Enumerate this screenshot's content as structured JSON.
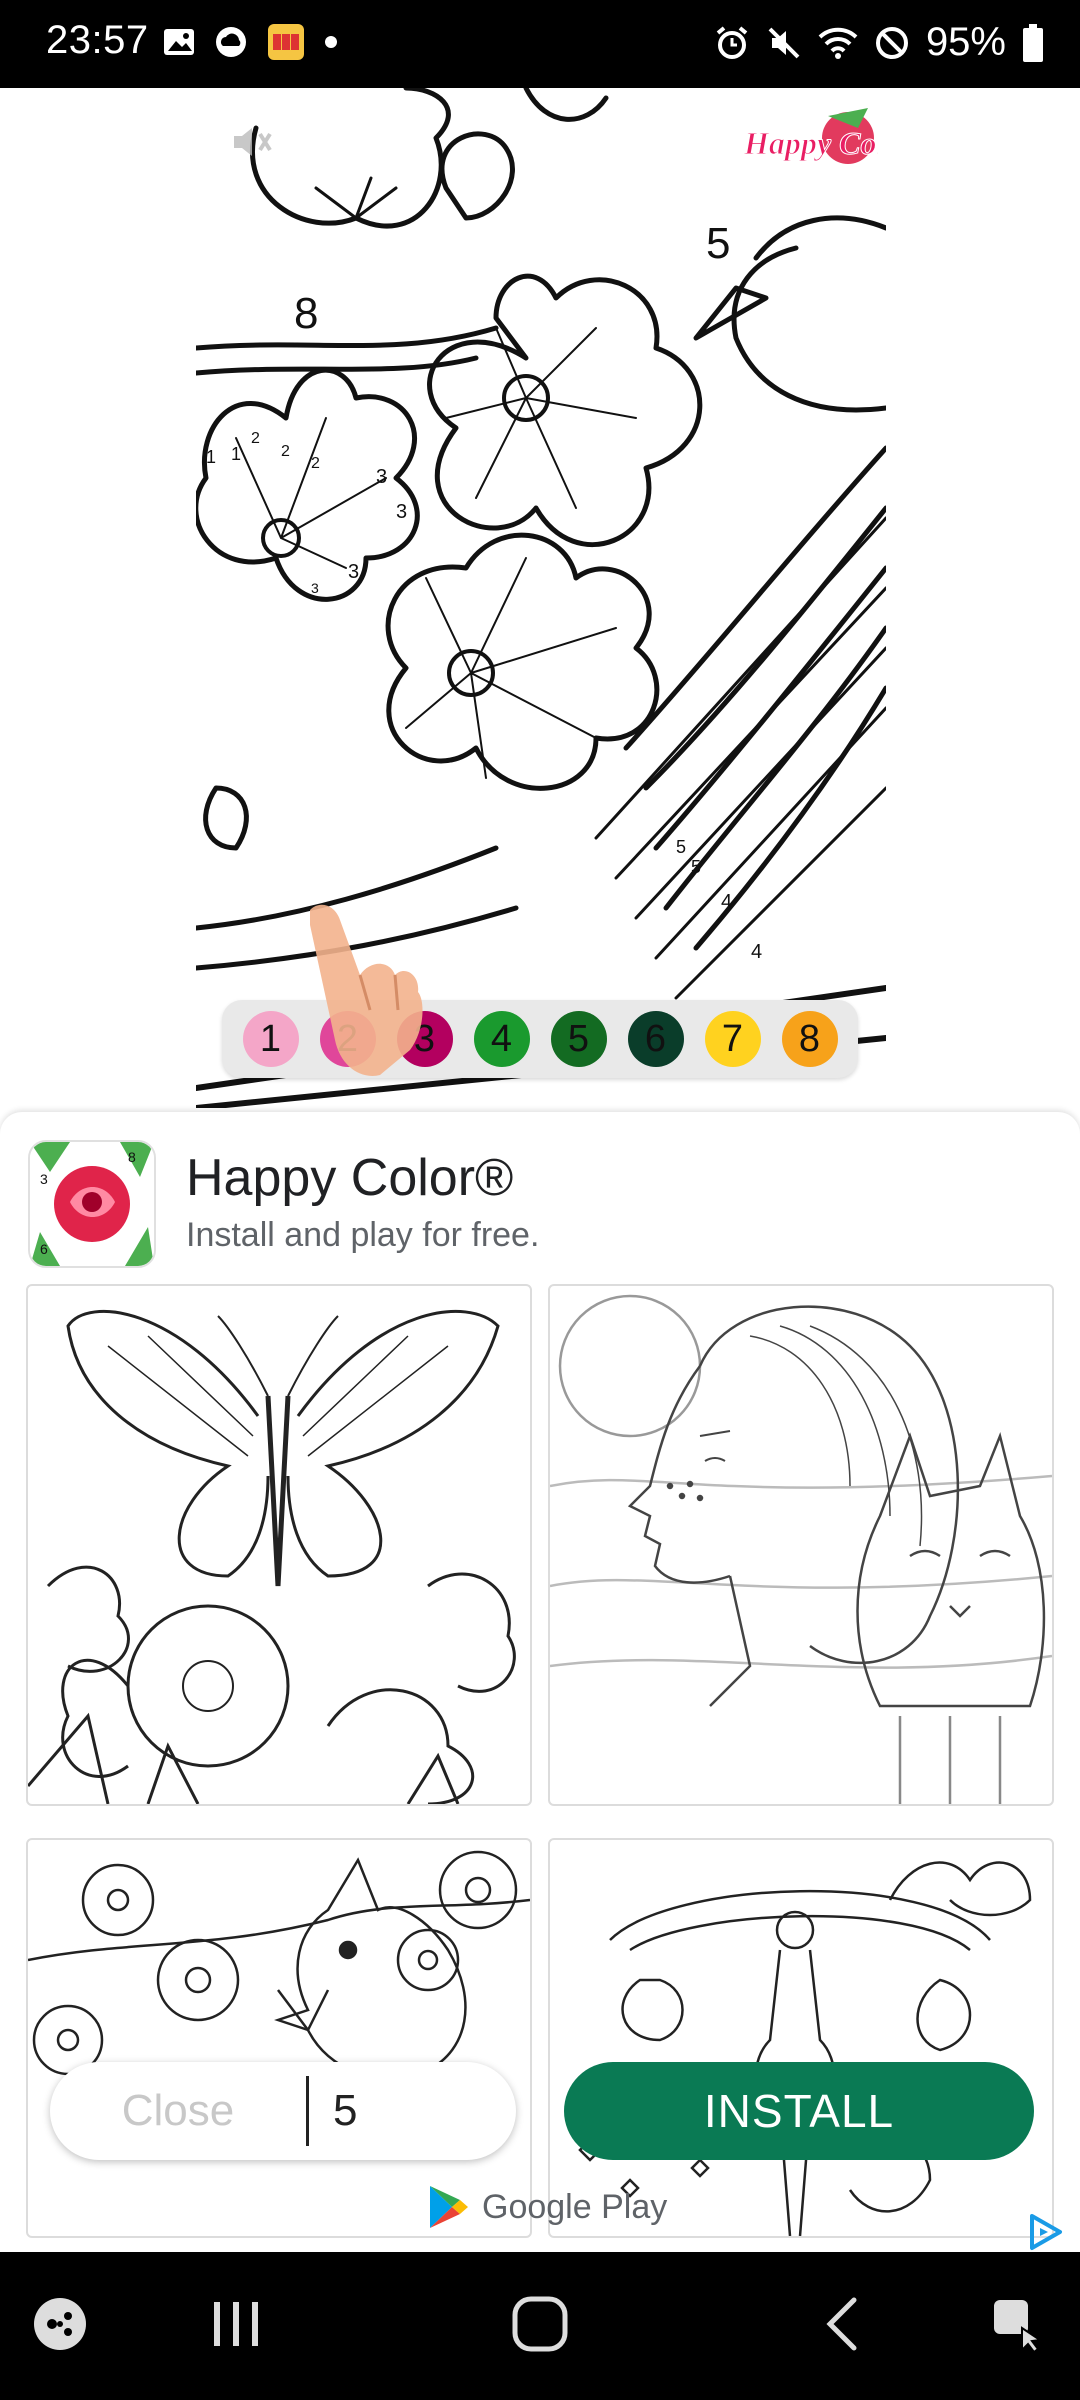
{
  "status_bar": {
    "time": "23:57",
    "battery_percent": "95%",
    "left_icons": [
      "gallery-icon",
      "cloud-icon",
      "game-icon",
      "dot-icon"
    ],
    "right_icons": [
      "alarm-icon",
      "mute-icon",
      "wifi-icon",
      "do-not-disturb-icon",
      "battery-icon"
    ]
  },
  "coloring": {
    "badge_text": "Happy Color",
    "numbers": [
      "8",
      "5",
      "1",
      "1",
      "2",
      "2",
      "2",
      "3",
      "3",
      "3",
      "3",
      "5",
      "5",
      "4",
      "4"
    ],
    "palette": [
      {
        "label": "1",
        "color": "#f4a6c8"
      },
      {
        "label": "2",
        "color": "#e0469a"
      },
      {
        "label": "3",
        "color": "#b3005f"
      },
      {
        "label": "4",
        "color": "#1a9a2e"
      },
      {
        "label": "5",
        "color": "#136b22"
      },
      {
        "label": "6",
        "color": "#0a3d2a"
      },
      {
        "label": "7",
        "color": "#ffd21f"
      },
      {
        "label": "8",
        "color": "#f7a21a"
      }
    ]
  },
  "ad": {
    "app_name": "Happy Color®",
    "subtitle": "Install and play for free.",
    "thumbnails": [
      "butterfly-flowers",
      "woman-with-cat",
      "bird-blossoms",
      "ornate-lantern"
    ],
    "close_label": "Close",
    "close_countdown": "5",
    "install_label": "INSTALL",
    "store_label": "Google Play",
    "install_color": "#0a7a54"
  },
  "nav_bar": {
    "items": [
      "game-launcher-icon",
      "recents-icon",
      "home-icon",
      "back-icon",
      "accessibility-icon"
    ]
  }
}
